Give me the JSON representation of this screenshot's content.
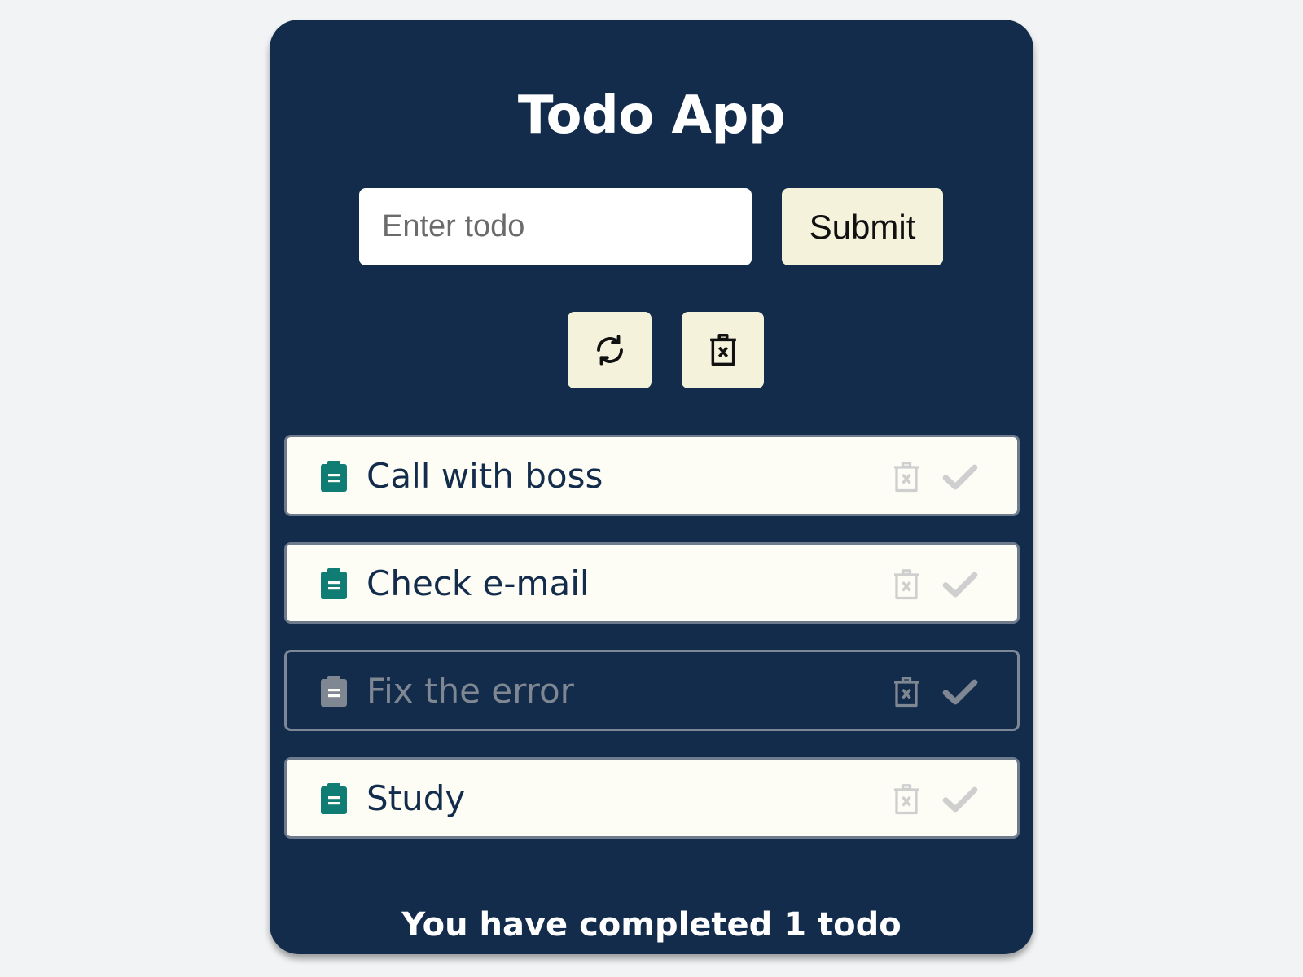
{
  "app": {
    "title": "Todo App"
  },
  "form": {
    "input_value": "",
    "input_placeholder": "Enter todo",
    "submit_label": "Submit"
  },
  "actions": {
    "refresh_icon": "refresh-icon",
    "clear_all_icon": "trash-x-icon"
  },
  "todos": [
    {
      "text": "Call with boss",
      "completed": false
    },
    {
      "text": "Check e-mail",
      "completed": false
    },
    {
      "text": "Fix the error",
      "completed": true
    },
    {
      "text": "Study",
      "completed": false
    }
  ],
  "footer": {
    "summary": "You have completed 1 todo"
  },
  "colors": {
    "background": "#f2f3f5",
    "card": "#142c4b",
    "button": "#f5f2dc",
    "item_bg": "#fdfdf6",
    "clipboard_icon": "#0f7d73",
    "clipboard_icon_done": "#7f8792",
    "action_icon_inactive": "#cfcfcf",
    "action_icon_done": "#7f8792"
  }
}
